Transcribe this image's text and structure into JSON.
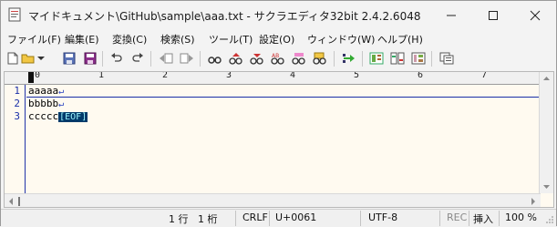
{
  "window": {
    "title": "マイドキュメント\\GitHub\\sample\\aaa.txt - サクラエディタ32bit 2.4.2.6048"
  },
  "menu": [
    "ファイル(F)",
    "編集(E)",
    "変換(C)",
    "検索(S)",
    "ツール(T)",
    "設定(O)",
    "ウィンドウ(W)",
    "ヘルプ(H)"
  ],
  "toolbar": {
    "icons": [
      "new-file-icon",
      "open-file-icon",
      "dropdown-arrow-icon",
      "save-icon",
      "save-all-icon",
      "undo-icon",
      "redo-icon",
      "jump-back-icon",
      "jump-forward-icon",
      "search-icon",
      "search-previous-icon",
      "search-next-icon",
      "replace-icon",
      "search-clear-icon",
      "grep-icon",
      "tag-jump-icon",
      "outline-icon",
      "compare-icon",
      "settings-icon",
      "window-list-icon"
    ]
  },
  "ruler": {
    "labels": [
      "0",
      "1",
      "2",
      "3",
      "4",
      "5",
      "6",
      "7"
    ]
  },
  "editor": {
    "lines": [
      {
        "num": "1",
        "text": "aaaaa",
        "eol": "↵"
      },
      {
        "num": "2",
        "text": "bbbbb",
        "eol": "↵"
      },
      {
        "num": "3",
        "text": "ccccc",
        "eof": "[EOF]"
      }
    ]
  },
  "status": {
    "line": "1 行",
    "column": "1 桁",
    "newline": "CRLF",
    "codepoint": "U+0061",
    "encoding": "UTF-8",
    "rec": "REC",
    "mode": "挿入",
    "zoom": "100 %"
  },
  "colors": {
    "editor_bg": "#fffaf0",
    "line_number": "#1a2fa8",
    "eof_bg": "#003a6a",
    "eof_fg": "#9ff6ff"
  }
}
